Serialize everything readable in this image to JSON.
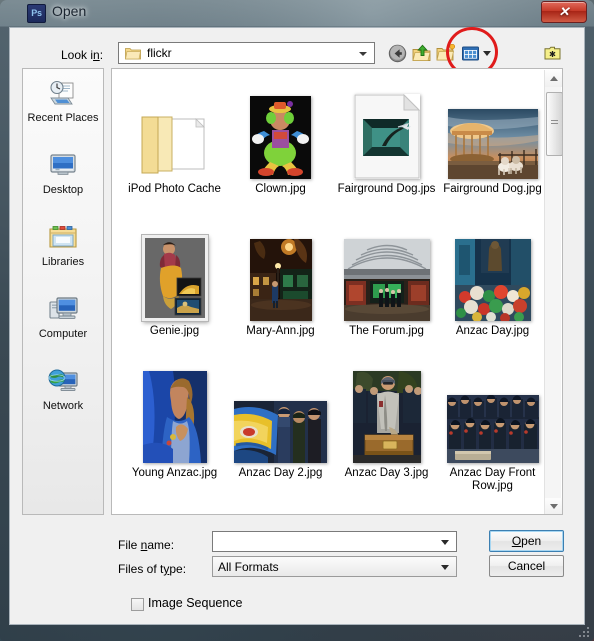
{
  "window": {
    "title": "Open",
    "app_icon": "photoshop-ps-icon",
    "app_icon_text": "Ps",
    "close_glyph": "✕"
  },
  "toolbar": {
    "lookin_label": "Look i",
    "lookin_label_underlined": "n",
    "lookin_label_suffix": ":",
    "lookin_value": "flickr",
    "lookin_icon": "folder-icon",
    "buttons": [
      {
        "name": "back-button",
        "icon": "back-arrow-icon",
        "label": "Back"
      },
      {
        "name": "up-one-level-button",
        "icon": "up-folder-icon",
        "label": "Up One Level"
      },
      {
        "name": "create-new-folder-button",
        "icon": "new-folder-icon",
        "label": "Create New Folder"
      },
      {
        "name": "views-button",
        "icon": "views-grid-icon",
        "label": "Views"
      },
      {
        "name": "tools-button",
        "icon": "tools-folder-icon",
        "label": "Tools"
      }
    ],
    "annotation": {
      "shape": "circle",
      "color": "#e01b1b",
      "target": "views-button"
    }
  },
  "places": {
    "items": [
      {
        "label": "Recent Places",
        "icon": "recent-places-icon"
      },
      {
        "label": "Desktop",
        "icon": "desktop-monitor-icon"
      },
      {
        "label": "Libraries",
        "icon": "libraries-folder-icon"
      },
      {
        "label": "Computer",
        "icon": "computer-icon"
      },
      {
        "label": "Network",
        "icon": "network-globe-icon"
      }
    ]
  },
  "files": {
    "items": [
      {
        "name": "iPod Photo Cache",
        "kind": "folder",
        "thumb": "folder-icon"
      },
      {
        "name": "Clown.jpg",
        "kind": "image",
        "thumb": "clown-photo"
      },
      {
        "name": "Fairground Dog.jps",
        "kind": "document",
        "thumb": "generic-jps-document-icon"
      },
      {
        "name": "Fairground Dog.jpg",
        "kind": "image",
        "thumb": "fairground-carousel-dogs-photo"
      },
      {
        "name": "Genie.jpg",
        "kind": "image",
        "thumb": "genie-photo",
        "framed": true
      },
      {
        "name": "Mary-Ann.jpg",
        "kind": "image",
        "thumb": "night-street-photo"
      },
      {
        "name": "The Forum.jpg",
        "kind": "image",
        "thumb": "forum-arcade-photo"
      },
      {
        "name": "Anzac Day.jpg",
        "kind": "image",
        "thumb": "flower-wreaths-photo"
      },
      {
        "name": "Young Anzac.jpg",
        "kind": "image",
        "thumb": "girl-blue-flag-photo"
      },
      {
        "name": "Anzac Day 2.jpg",
        "kind": "image",
        "thumb": "yellow-blue-banner-photo"
      },
      {
        "name": "Anzac Day 3.jpg",
        "kind": "image",
        "thumb": "man-coffin-photo"
      },
      {
        "name": "Anzac Day Front Row.jpg",
        "kind": "image",
        "thumb": "seated-veterans-photo"
      }
    ]
  },
  "scrollbar": {
    "up_glyph": "▲",
    "down_glyph": "▼",
    "position": "near-top"
  },
  "form": {
    "filename_label": "File ",
    "filename_label_underlined": "n",
    "filename_label_suffix": "ame:",
    "filename_value": "",
    "filename_placeholder": "",
    "filetype_label": "Files of t",
    "filetype_label_underlined": "y",
    "filetype_label_suffix": "pe:",
    "filetype_value": "All Formats",
    "open_label_pre": "",
    "open_label_underlined": "O",
    "open_label_post": "pen",
    "cancel_label": "Cancel",
    "image_sequence_label": "Image Sequence",
    "image_sequence_checked": false
  }
}
